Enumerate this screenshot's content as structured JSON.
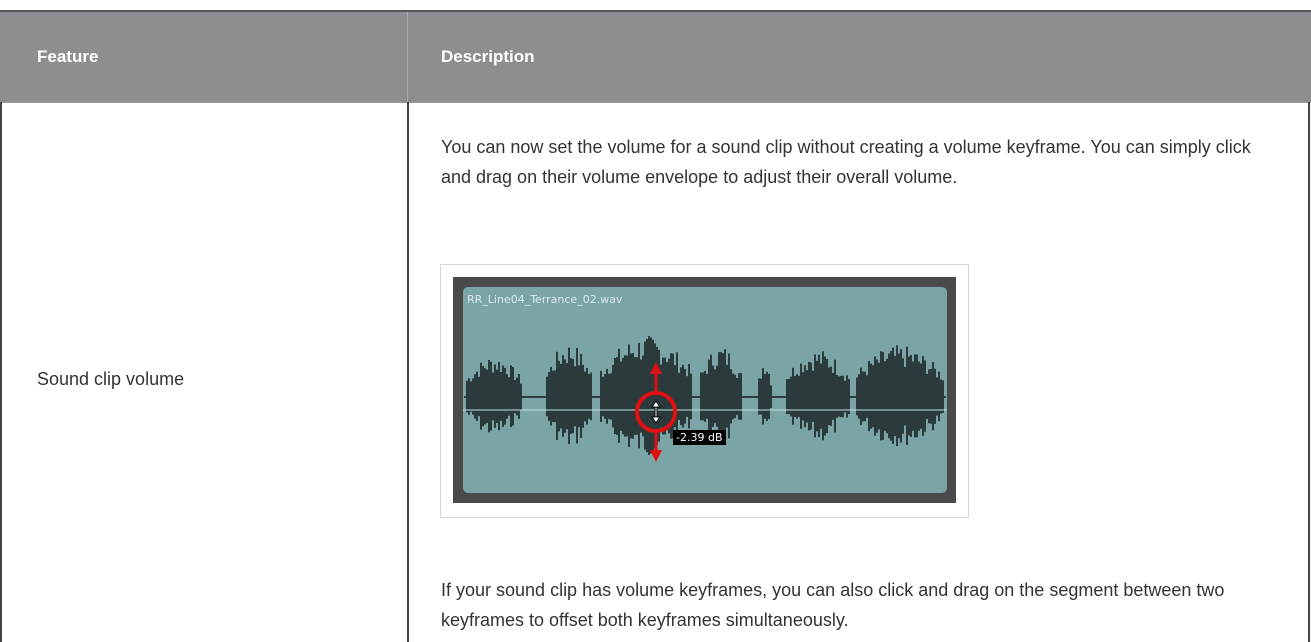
{
  "table": {
    "headers": {
      "feature": "Feature",
      "description": "Description"
    },
    "row": {
      "feature": "Sound clip volume",
      "description_intro": "You can now set the volume for a sound clip without creating a volume keyframe. You can simply click and drag on their volume envelope to adjust their overall volume.",
      "description_outro": "If your sound clip has volume keyframes, you can also click and drag on the segment between two keyframes to offset both keyframes simultaneously."
    }
  },
  "figure": {
    "clip_name": "RR_Line04_Terrance_02.wav",
    "volume_label": "-2.39 dB"
  },
  "colors": {
    "header_bg": "#8c8e92",
    "clip_bg": "#7aa4a5",
    "waveform": "#2b3b3b",
    "arrow": "#e01010"
  }
}
